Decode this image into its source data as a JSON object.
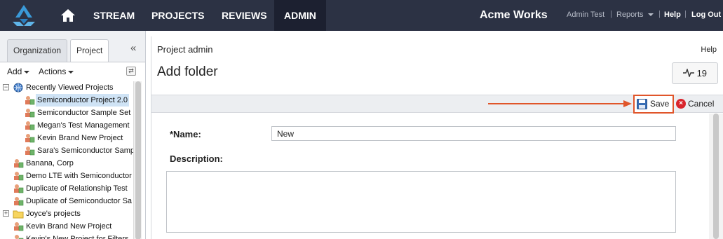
{
  "nav": {
    "items": [
      "STREAM",
      "PROJECTS",
      "REVIEWS",
      "ADMIN"
    ],
    "active": "ADMIN",
    "brand": "Acme Works",
    "user": "Admin Test",
    "reports": "Reports",
    "help": "Help",
    "logout": "Log Out",
    "separator": "|",
    "colors": {
      "bar": "#2c3244",
      "active": "#1c2030",
      "logo": "#3a9ad9"
    }
  },
  "left_panel": {
    "tabs": [
      "Organization",
      "Project"
    ],
    "active_tab": "Project",
    "collapse_icon": "double-chevron-left-icon",
    "add_label": "Add",
    "actions_label": "Actions",
    "tree": [
      {
        "label": "Recently Viewed Projects",
        "level": 0,
        "icon": "globe-icon",
        "expander": "−",
        "selected": false
      },
      {
        "label": "Semiconductor Project 2.0",
        "level": 1,
        "icon": "project-icon",
        "expander": "",
        "selected": true
      },
      {
        "label": "Semiconductor Sample Set",
        "level": 1,
        "icon": "project-icon",
        "expander": "",
        "selected": false
      },
      {
        "label": "Megan's Test Management",
        "level": 1,
        "icon": "project-icon",
        "expander": "",
        "selected": false
      },
      {
        "label": "Kevin Brand New Project",
        "level": 1,
        "icon": "project-icon",
        "expander": "",
        "selected": false
      },
      {
        "label": "Sara's Semiconductor Samp",
        "level": 1,
        "icon": "project-icon",
        "expander": "",
        "selected": false
      },
      {
        "label": "Banana, Corp",
        "level": 0,
        "icon": "project-icon",
        "expander": "",
        "selected": false
      },
      {
        "label": "Demo LTE with Semiconductor",
        "level": 0,
        "icon": "project-icon",
        "expander": "",
        "selected": false
      },
      {
        "label": "Duplicate of Relationship Test",
        "level": 0,
        "icon": "project-icon",
        "expander": "",
        "selected": false
      },
      {
        "label": "Duplicate of Semiconductor Sa",
        "level": 0,
        "icon": "project-icon",
        "expander": "",
        "selected": false
      },
      {
        "label": "Joyce's projects",
        "level": 0,
        "icon": "folder-icon",
        "expander": "+",
        "selected": false
      },
      {
        "label": "Kevin Brand New Project",
        "level": 0,
        "icon": "project-icon",
        "expander": "",
        "selected": false
      },
      {
        "label": "Kevin's New Project for Filters",
        "level": 0,
        "icon": "project-icon",
        "expander": "",
        "selected": false
      }
    ]
  },
  "main": {
    "breadcrumb": "Project admin",
    "help": "Help",
    "title": "Add folder",
    "activity_count": "19",
    "save_label": "Save",
    "cancel_label": "Cancel",
    "name_label": "*Name:",
    "name_value": "New",
    "description_label": "Description:",
    "description_value": "",
    "colors": {
      "highlight": "#e0552a",
      "cancel": "#d9242b"
    }
  }
}
